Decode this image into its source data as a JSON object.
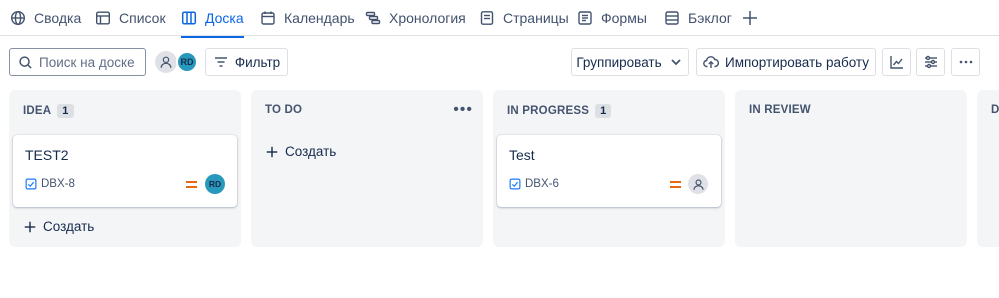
{
  "tabs": [
    {
      "label": "Сводка",
      "icon": "globe-icon"
    },
    {
      "label": "Список",
      "icon": "list-icon"
    },
    {
      "label": "Доска",
      "icon": "board-icon",
      "active": true
    },
    {
      "label": "Календарь",
      "icon": "calendar-icon"
    },
    {
      "label": "Хронология",
      "icon": "timeline-icon"
    },
    {
      "label": "Страницы",
      "icon": "pages-icon"
    },
    {
      "label": "Формы",
      "icon": "forms-icon"
    },
    {
      "label": "Бэклог",
      "icon": "backlog-icon"
    }
  ],
  "toolbar": {
    "search_placeholder": "Поиск на доске",
    "filter_label": "Фильтр",
    "group_label": "Группировать",
    "import_label": "Импортировать работу",
    "avatar_initials": "RD"
  },
  "columns": [
    {
      "title": "IDEA",
      "count": "1",
      "create_label": "Создать",
      "cards": [
        {
          "title": "TEST2",
          "key": "DBX-8",
          "assignee": "RD"
        }
      ]
    },
    {
      "title": "TO DO",
      "create_label": "Создать",
      "cards": []
    },
    {
      "title": "IN PROGRESS",
      "count": "1",
      "cards": [
        {
          "title": "Test",
          "key": "DBX-6",
          "assignee": ""
        }
      ]
    },
    {
      "title": "IN REVIEW",
      "cards": []
    },
    {
      "title": "D",
      "cards": []
    }
  ],
  "colors": {
    "accent": "#0c66e4",
    "priority_medium": "#e56910",
    "avatar_rd": "#2898bd",
    "column_bg": "#f4f5f7"
  }
}
